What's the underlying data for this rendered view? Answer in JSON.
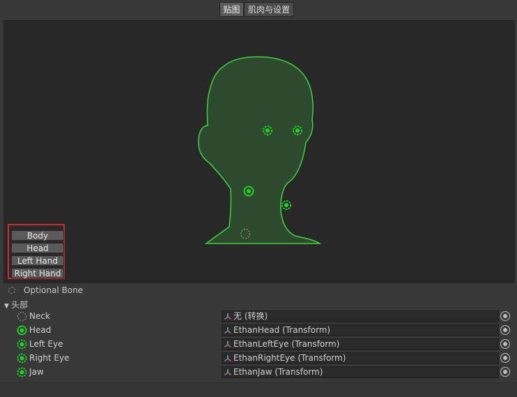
{
  "tabs": [
    {
      "label": "贴图",
      "active": true
    },
    {
      "label": "肌肉与设置",
      "active": false
    }
  ],
  "body_parts": [
    "Body",
    "Head",
    "Left Hand",
    "Right Hand"
  ],
  "legend": {
    "optional_bone": "Optional Bone"
  },
  "section": {
    "title": "头部",
    "expanded": true
  },
  "bones": [
    {
      "name": "Neck",
      "icon": "empty-bone-icon",
      "value": "无 (转换)"
    },
    {
      "name": "Head",
      "icon": "required-bone-icon",
      "value": "EthanHead (Transform)"
    },
    {
      "name": "Left Eye",
      "icon": "optional-bone-icon",
      "value": "EthanLeftEye (Transform)"
    },
    {
      "name": "Right Eye",
      "icon": "optional-bone-icon",
      "value": "EthanRightEye (Transform)"
    },
    {
      "name": "Jaw",
      "icon": "optional-bone-icon",
      "value": "EthanJaw (Transform)"
    }
  ],
  "colors": {
    "head_fill": "#2e4a2e",
    "head_stroke": "#3bd63b",
    "bone_green": "#22d422",
    "highlight_box": "#d22b2b"
  }
}
